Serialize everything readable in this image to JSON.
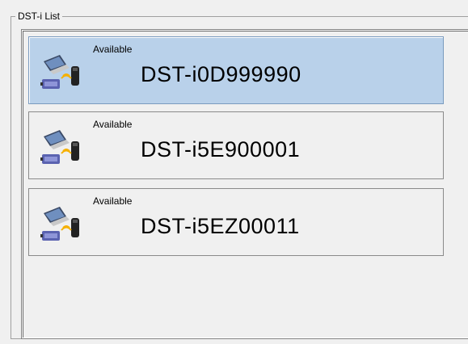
{
  "group": {
    "title": "DST-i List"
  },
  "devices": [
    {
      "status": "Available",
      "name": "DST-i0D999990",
      "selected": true
    },
    {
      "status": "Available",
      "name": "DST-i5E900001",
      "selected": false
    },
    {
      "status": "Available",
      "name": "DST-i5EZ00011",
      "selected": false
    }
  ],
  "colors": {
    "selected_background": "#b9d1ea",
    "panel_background": "#f0f0f0"
  },
  "icons": {
    "device": "laptop-wireless-dongle-icon"
  }
}
